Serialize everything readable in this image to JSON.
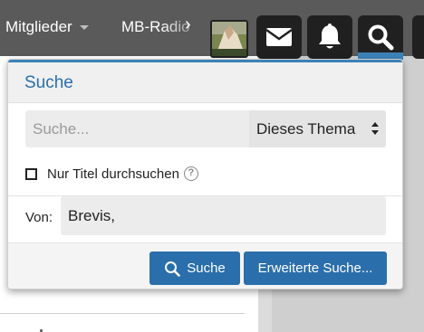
{
  "nav": {
    "items": [
      {
        "label": "Mitglieder"
      },
      {
        "label": "MB-Radio"
      }
    ],
    "scroll_glyph": "›"
  },
  "icons": {
    "avatar": "avatar",
    "messages": "envelope-icon",
    "alerts": "bell-icon",
    "search": "search-icon"
  },
  "colors": {
    "accent": "#2a6fab",
    "topbar": "#5a5a5a",
    "icon_button": "#202020"
  },
  "search_popup": {
    "title": "Suche",
    "search_placeholder": "Suche...",
    "scope_value": "Dieses Thema",
    "title_only_label": "Nur Titel durchsuchen",
    "title_only_checked": false,
    "by_label": "Von:",
    "by_value": "Brevis,",
    "search_button": "Suche",
    "advanced_button": "Erweiterte Suche..."
  }
}
